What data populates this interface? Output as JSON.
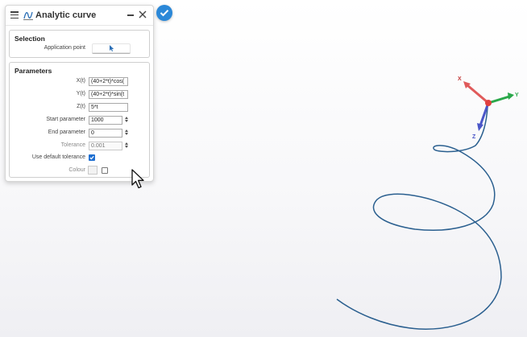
{
  "panel": {
    "title": "Analytic curve",
    "icons": {
      "menu": "hamburger-icon",
      "curve": "curve-icon",
      "minimize": "minimize-icon",
      "close": "close-icon"
    }
  },
  "selection": {
    "title": "Selection",
    "application_point_label": "Application point",
    "picker_icon": "pointer-icon"
  },
  "parameters": {
    "title": "Parameters",
    "x_label": "X(t)",
    "x_value": "(40+2*t)*cos(",
    "y_label": "Y(t)",
    "y_value": "(40+2*t)*sin(t",
    "z_label": "Z(t)",
    "z_value": "5*t",
    "start_label": "Start parameter",
    "start_value": "1000",
    "end_label": "End parameter",
    "end_value": "0",
    "tolerance_label": "Tolerance",
    "tolerance_value": "0.001",
    "default_tolerance_label": "Use default tolerance",
    "default_tolerance_checked": true,
    "colour_label": "Colour",
    "colour_checked": false
  },
  "confirm": {
    "icon": "checkmark-icon",
    "color": "#2b88d8"
  },
  "triad": {
    "x_label": "X",
    "y_label": "Y",
    "z_label": "Z",
    "x_color": "#e05a5a",
    "y_color": "#2aa84a",
    "z_color": "#4a56c8"
  },
  "curve": {
    "color": "#2a5f8f"
  }
}
